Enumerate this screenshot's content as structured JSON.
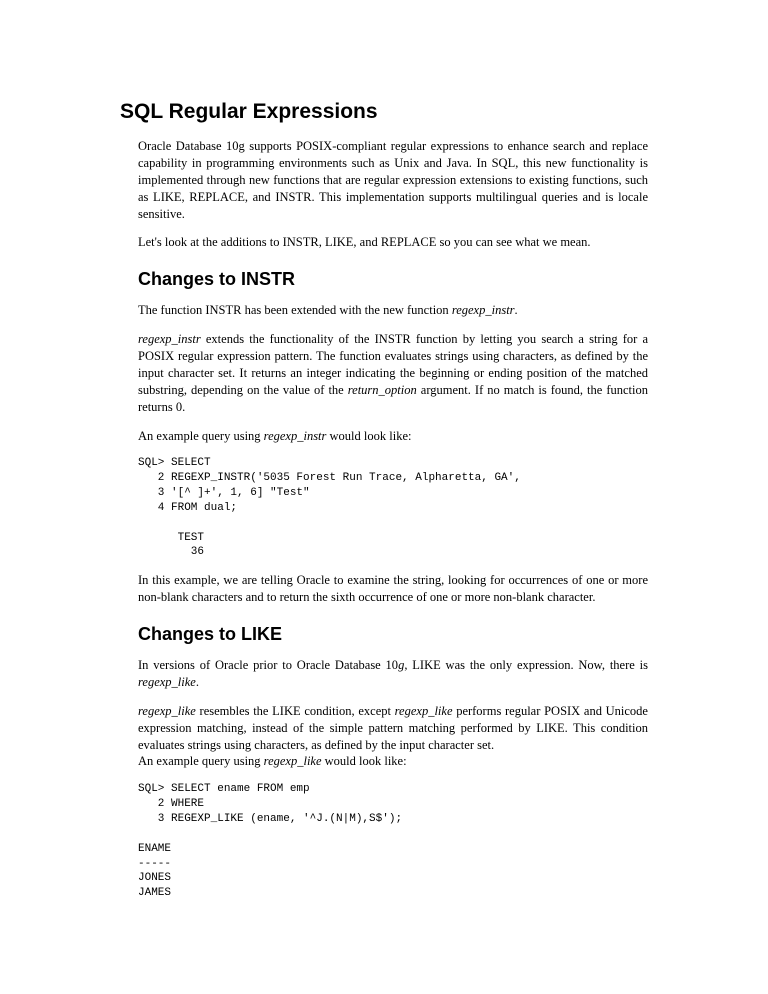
{
  "title": "SQL Regular Expressions",
  "intro_p1_a": "Oracle Database 10g supports POSIX-compliant regular expressions to enhance search and replace capability in programming environments such as Unix and Java. In SQL, this new functionality is implemented through new functions that are regular expression extensions to existing functions, such as LIKE, REPLACE, and INSTR. This implementation supports multilingual queries and is locale sensitive.",
  "intro_p2": "Let's look at the additions to INSTR, LIKE, and REPLACE so you can see what we mean.",
  "instr": {
    "heading": "Changes to INSTR",
    "p1_a": "The function INSTR has been extended with the new function ",
    "p1_b": "regexp_instr",
    "p1_c": ".",
    "p2_a": "regexp_instr",
    "p2_b": " extends the functionality of the INSTR function by letting you search a string for a POSIX regular expression pattern. The function evaluates strings using characters, as defined by the input character set. It returns an integer indicating the beginning or ending position of the matched substring, depending on the value of the ",
    "p2_c": "return_option",
    "p2_d": " argument. If no match is found, the function returns 0.",
    "p3_a": "An example query using ",
    "p3_b": "regexp_instr",
    "p3_c": " would look like:",
    "code": "SQL> SELECT\n   2 REGEXP_INSTR('5035 Forest Run Trace, Alpharetta, GA',\n   3 '[^ ]+', 1, 6] \"Test\"\n   4 FROM dual;\n\n      TEST\n        36",
    "p4": "In this example, we are telling Oracle to examine the string, looking for occurrences of one or more non-blank characters and to return the sixth occurrence of one or more non-blank character."
  },
  "like": {
    "heading": "Changes to LIKE",
    "p1_a": "In versions of Oracle prior to Oracle Database 10",
    "p1_b": "g",
    "p1_c": ", LIKE was the only expression. Now, there is ",
    "p1_d": "regexp_like",
    "p1_e": ".",
    "p2_a": "regexp_like",
    "p2_b": " resembles the LIKE condition, except ",
    "p2_c": "regexp_like",
    "p2_d": " performs regular POSIX and Unicode expression matching, instead of the simple pattern matching performed by LIKE. This condition evaluates strings using characters, as defined by the input character set.",
    "p3_a": "An example query using ",
    "p3_b": "regexp_like",
    "p3_c": " would look like:",
    "code": "SQL> SELECT ename FROM emp\n   2 WHERE\n   3 REGEXP_LIKE (ename, '^J.(N|M),S$');\n\nENAME\n-----\nJONES\nJAMES"
  }
}
